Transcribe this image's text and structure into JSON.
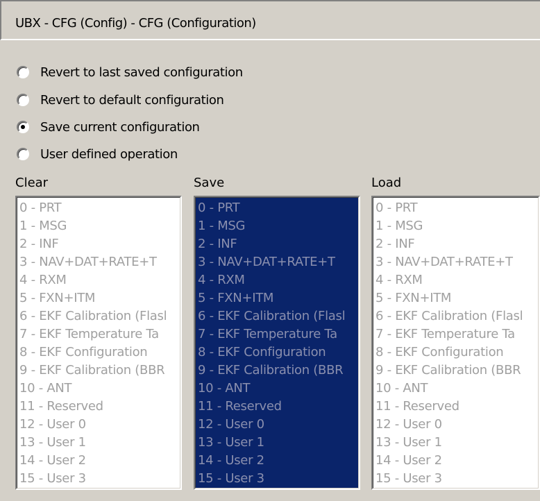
{
  "title": "UBX - CFG (Config) - CFG (Configuration)",
  "radio_options": [
    {
      "label": "Revert to last saved configuration",
      "checked": false
    },
    {
      "label": "Revert to default configuration",
      "checked": false
    },
    {
      "label": "Save current configuration",
      "checked": true
    },
    {
      "label": "User defined operation",
      "checked": false
    }
  ],
  "lists": {
    "clear": {
      "label": "Clear",
      "items": [
        "0 - PRT",
        "1 - MSG",
        "2 - INF",
        "3 - NAV+DAT+RATE+T",
        "4 - RXM",
        "5 - FXN+ITM",
        "6 - EKF Calibration (Flasl",
        "7 - EKF Temperature Ta",
        "8 - EKF Configuration",
        "9 - EKF Calibration (BBR",
        "10 - ANT",
        "11 - Reserved",
        "12 - User 0",
        "13 - User 1",
        "14 - User 2",
        "15 - User 3"
      ]
    },
    "save": {
      "label": "Save",
      "items": [
        "0 - PRT",
        "1 - MSG",
        "2 - INF",
        "3 - NAV+DAT+RATE+T",
        "4 - RXM",
        "5 - FXN+ITM",
        "6 - EKF Calibration (Flasl",
        "7 - EKF Temperature Ta",
        "8 - EKF Configuration",
        "9 - EKF Calibration (BBR",
        "10 - ANT",
        "11 - Reserved",
        "12 - User 0",
        "13 - User 1",
        "14 - User 2",
        "15 - User 3"
      ]
    },
    "load": {
      "label": "Load",
      "items": [
        "0 - PRT",
        "1 - MSG",
        "2 - INF",
        "3 - NAV+DAT+RATE+T",
        "4 - RXM",
        "5 - FXN+ITM",
        "6 - EKF Calibration (Flasl",
        "7 - EKF Temperature Ta",
        "8 - EKF Configuration",
        "9 - EKF Calibration (BBR",
        "10 - ANT",
        "11 - Reserved",
        "12 - User 0",
        "13 - User 1",
        "14 - User 2",
        "15 - User 3"
      ]
    }
  },
  "colors": {
    "panel_bg": "#d4d0c8",
    "selection_bg": "#0a246a",
    "disabled_text": "#a0a0a0"
  }
}
